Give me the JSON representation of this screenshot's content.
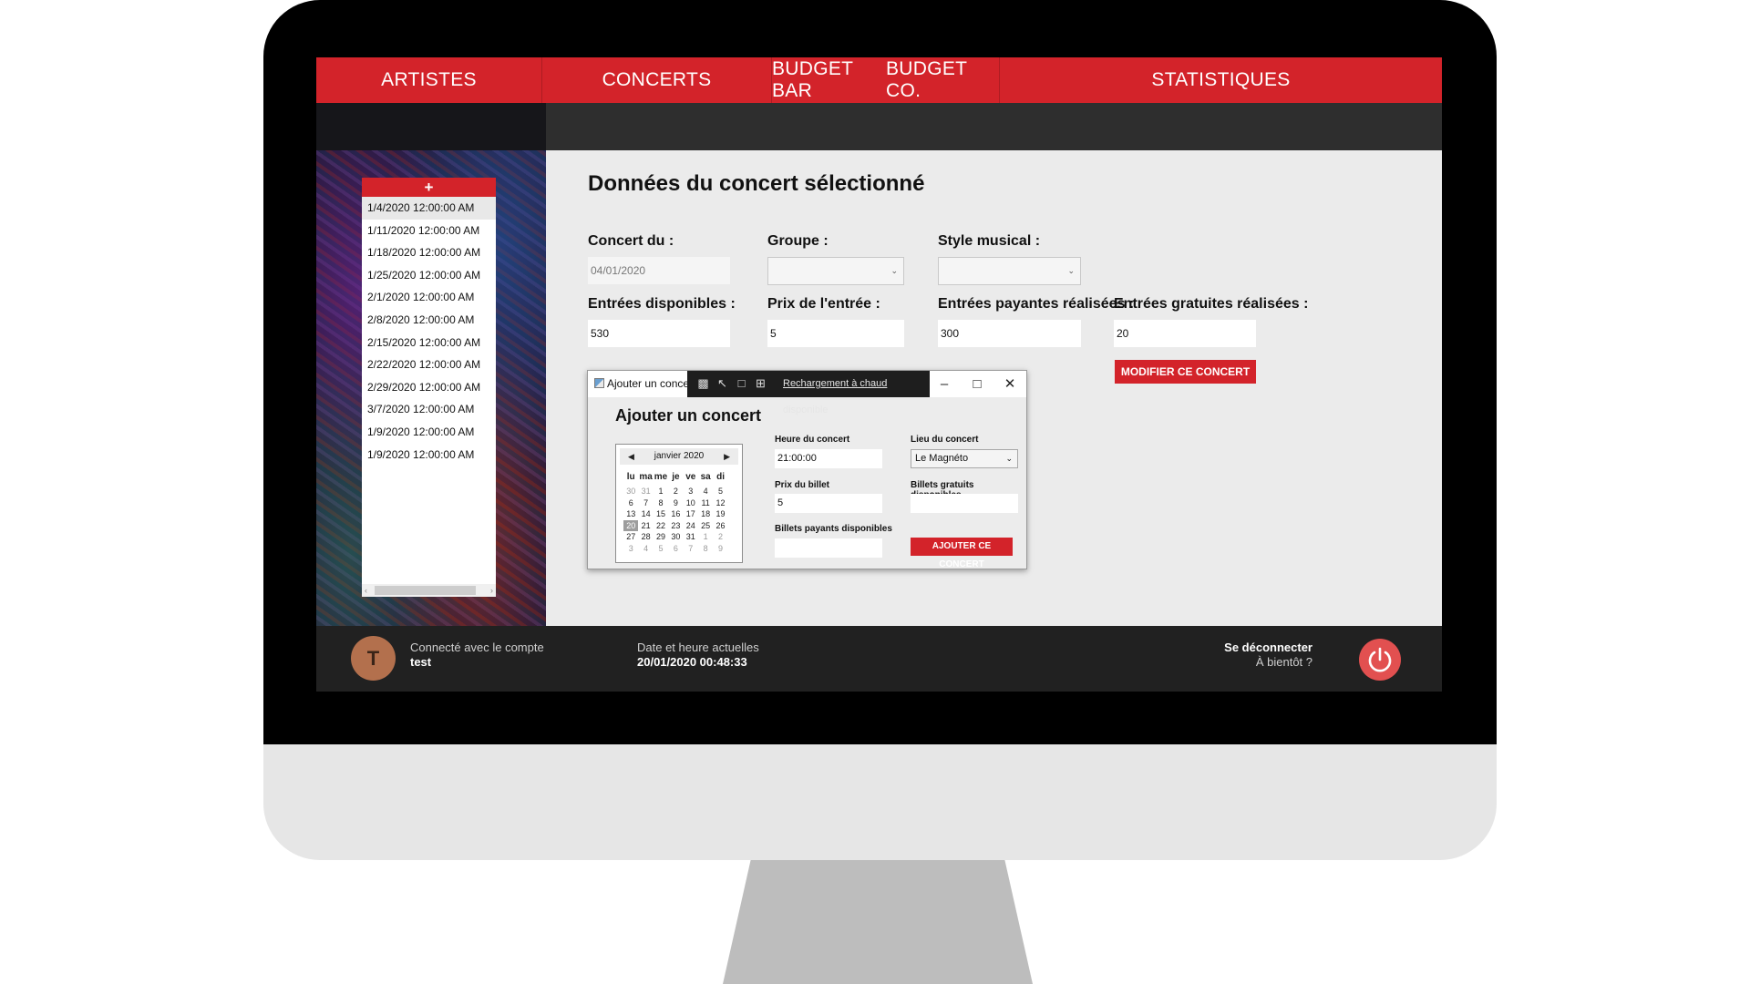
{
  "nav": {
    "items": [
      {
        "label": "ARTISTES"
      },
      {
        "label": "CONCERTS"
      },
      {
        "label": "BUDGET BAR"
      },
      {
        "label": "BUDGET CO."
      },
      {
        "label": "STATISTIQUES"
      }
    ]
  },
  "concert_list": {
    "add_label": "+",
    "items": [
      "1/4/2020 12:00:00 AM",
      "1/11/2020 12:00:00 AM",
      "1/18/2020 12:00:00 AM",
      "1/25/2020 12:00:00 AM",
      "2/1/2020 12:00:00 AM",
      "2/8/2020 12:00:00 AM",
      "2/15/2020 12:00:00 AM",
      "2/22/2020 12:00:00 AM",
      "2/29/2020 12:00:00 AM",
      "3/7/2020 12:00:00 AM",
      "1/9/2020 12:00:00 AM",
      "1/9/2020 12:00:00 AM"
    ],
    "selected_index": 0
  },
  "details": {
    "title": "Données du concert sélectionné",
    "concert_du_label": "Concert du :",
    "concert_du_value": "04/01/2020",
    "groupe_label": "Groupe :",
    "groupe_value": "",
    "style_label": "Style musical :",
    "style_value": "",
    "entrees_dispo_label": "Entrées disponibles :",
    "entrees_dispo_value": "530",
    "prix_label": "Prix de l'entrée :",
    "prix_value": "5",
    "payantes_label": "Entrées payantes réalisées :",
    "payantes_value": "300",
    "gratuites_label": "Entrées gratuites réalisées :",
    "gratuites_value": "20",
    "modifier_button": "MODIFIER CE CONCERT"
  },
  "dialog": {
    "window_title": "Ajouter un concert",
    "hot_reload_link": "Rechargement à chaud",
    "hot_reload_suffix": "disponible",
    "heading": "Ajouter un concert",
    "calendar": {
      "month_label": "janvier 2020",
      "weekdays": [
        "lu",
        "ma",
        "me",
        "je",
        "ve",
        "sa",
        "di"
      ],
      "days": [
        {
          "d": "30",
          "other": true
        },
        {
          "d": "31",
          "other": true
        },
        {
          "d": "1"
        },
        {
          "d": "2"
        },
        {
          "d": "3"
        },
        {
          "d": "4"
        },
        {
          "d": "5"
        },
        {
          "d": "6"
        },
        {
          "d": "7"
        },
        {
          "d": "8"
        },
        {
          "d": "9"
        },
        {
          "d": "10"
        },
        {
          "d": "11"
        },
        {
          "d": "12"
        },
        {
          "d": "13"
        },
        {
          "d": "14"
        },
        {
          "d": "15"
        },
        {
          "d": "16"
        },
        {
          "d": "17"
        },
        {
          "d": "18"
        },
        {
          "d": "19"
        },
        {
          "d": "20",
          "today": true
        },
        {
          "d": "21"
        },
        {
          "d": "22"
        },
        {
          "d": "23"
        },
        {
          "d": "24"
        },
        {
          "d": "25"
        },
        {
          "d": "26"
        },
        {
          "d": "27"
        },
        {
          "d": "28"
        },
        {
          "d": "29"
        },
        {
          "d": "30"
        },
        {
          "d": "31"
        },
        {
          "d": "1",
          "other": true
        },
        {
          "d": "2",
          "other": true
        },
        {
          "d": "3",
          "other": true
        },
        {
          "d": "4",
          "other": true
        },
        {
          "d": "5",
          "other": true
        },
        {
          "d": "6",
          "other": true
        },
        {
          "d": "7",
          "other": true
        },
        {
          "d": "8",
          "other": true
        },
        {
          "d": "9",
          "other": true
        }
      ]
    },
    "heure_label": "Heure du concert",
    "heure_value": "21:00:00",
    "lieu_label": "Lieu du concert",
    "lieu_value": "Le Magnéto",
    "prix_label": "Prix du billet",
    "prix_value": "5",
    "gratuits_label": "Billets gratuits disponibles",
    "gratuits_value": "",
    "payants_label": "Billets payants disponibles",
    "payants_value": "",
    "ajouter_button": "AJOUTER CE CONCERT"
  },
  "footer": {
    "avatar_letter": "T",
    "connected_label": "Connecté avec le compte",
    "username": "test",
    "datetime_label": "Date et heure actuelles",
    "datetime_value": "20/01/2020 00:48:33",
    "logout_label": "Se déconnecter",
    "logout_sub": "À bientôt ?"
  },
  "colors": {
    "accent": "#d3232a",
    "dark": "#212121",
    "power": "#e25050"
  }
}
